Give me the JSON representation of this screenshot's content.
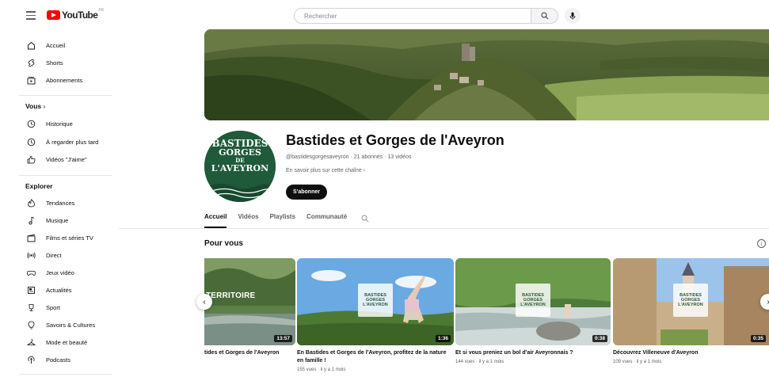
{
  "header": {
    "logo_text": "YouTube",
    "logo_region": "FR",
    "search_placeholder": "Rechercher"
  },
  "sidebar": {
    "main": [
      {
        "label": "Accueil",
        "icon": "home-icon"
      },
      {
        "label": "Shorts",
        "icon": "shorts-icon"
      },
      {
        "label": "Abonnements",
        "icon": "subscriptions-icon"
      }
    ],
    "you_title": "Vous",
    "you_items": [
      {
        "label": "Historique",
        "icon": "history-icon"
      },
      {
        "label": "À regarder plus tard",
        "icon": "watch-later-icon"
      },
      {
        "label": "Vidéos \"J'aime\"",
        "icon": "like-icon"
      }
    ],
    "explore_title": "Explorer",
    "explore_items": [
      {
        "label": "Tendances",
        "icon": "trending-icon"
      },
      {
        "label": "Musique",
        "icon": "music-icon"
      },
      {
        "label": "Films et séries TV",
        "icon": "movies-icon"
      },
      {
        "label": "Direct",
        "icon": "live-icon"
      },
      {
        "label": "Jeux vidéo",
        "icon": "gaming-icon"
      },
      {
        "label": "Actualités",
        "icon": "news-icon"
      },
      {
        "label": "Sport",
        "icon": "sport-icon"
      },
      {
        "label": "Savoirs & Cultures",
        "icon": "learning-icon"
      },
      {
        "label": "Mode et beauté",
        "icon": "fashion-icon"
      },
      {
        "label": "Podcasts",
        "icon": "podcast-icon"
      }
    ]
  },
  "channel": {
    "avatar_lines": [
      "BASTIDES",
      "GORGES",
      "DE",
      "L'AVEYRON"
    ],
    "name": "Bastides et Gorges de l'Aveyron",
    "meta": "@bastidesgorgesaveyron · 21 abonnés · 13 vidéos",
    "more": "En savoir plus sur cette chaîne",
    "subscribe_label": "S'abonner"
  },
  "tabs": [
    "Accueil",
    "Vidéos",
    "Playlists",
    "Communauté"
  ],
  "section": {
    "title": "Pour vous"
  },
  "videos": [
    {
      "title": "tides et Gorges de l'Aveyron",
      "meta": "",
      "duration": "13:57",
      "overlay": "TERRITOIRE"
    },
    {
      "title": "En Bastides et Gorges de l'Aveyron, profitez de la nature en famille !",
      "meta": "155 vues · il y a 1 mois",
      "duration": "1:36"
    },
    {
      "title": "Et si vous preniez un bol d'air Aveyronnais ?",
      "meta": "144 vues · il y a 1 mois",
      "duration": "0:38"
    },
    {
      "title": "Découvrez Villeneuve d'Aveyron",
      "meta": "109 vues · il y a 1 mois",
      "duration": "0:35"
    }
  ],
  "colors": {
    "brand_red": "#ff0000",
    "channel_green": "#1f5a3a",
    "text_primary": "#0f0f0f",
    "text_secondary": "#606060"
  }
}
